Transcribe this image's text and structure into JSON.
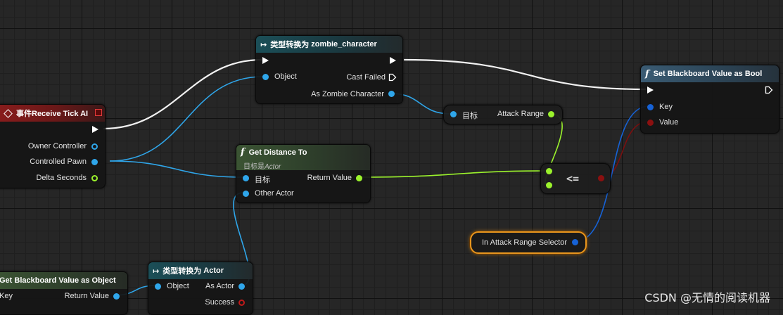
{
  "nodes": {
    "cast_zombie": {
      "prefix": "类型转换为",
      "target": "zombie_character",
      "pin_object": "Object",
      "pin_cast_failed": "Cast Failed",
      "pin_as": "As Zombie Character"
    },
    "event_tick": {
      "title": "事件Receive Tick AI",
      "pin_owner": "Owner Controller",
      "pin_pawn": "Controlled Pawn",
      "pin_delta": "Delta Seconds"
    },
    "get_distance": {
      "title": "Get Distance To",
      "subtitle_prefix": "目标是",
      "subtitle_class": "Actor",
      "pin_target": "目标",
      "pin_other": "Other Actor",
      "pin_return": "Return Value"
    },
    "attack_range": {
      "pin_target": "目标",
      "pin_value": "Attack Range"
    },
    "compare": {
      "operator": "<="
    },
    "set_bb_bool": {
      "title": "Set Blackboard Value as Bool",
      "pin_key": "Key",
      "pin_value": "Value"
    },
    "selector": {
      "label": "In Attack Range Selector"
    },
    "get_bb_object": {
      "title": "Get Blackboard Value as Object",
      "pin_key": "Key",
      "pin_return": "Return Value"
    },
    "cast_actor": {
      "prefix": "类型转换为",
      "target": "Actor",
      "pin_object": "Object",
      "pin_as": "As Actor",
      "pin_success": "Success"
    }
  },
  "watermark": "CSDN @无情的阅读机器",
  "colors": {
    "exec": "#ffffff",
    "object": "#2fa6ea",
    "float": "#9bf22c",
    "bool": "#8b1010",
    "struct": "#1662d6",
    "selected_outline": "#e8961e"
  }
}
